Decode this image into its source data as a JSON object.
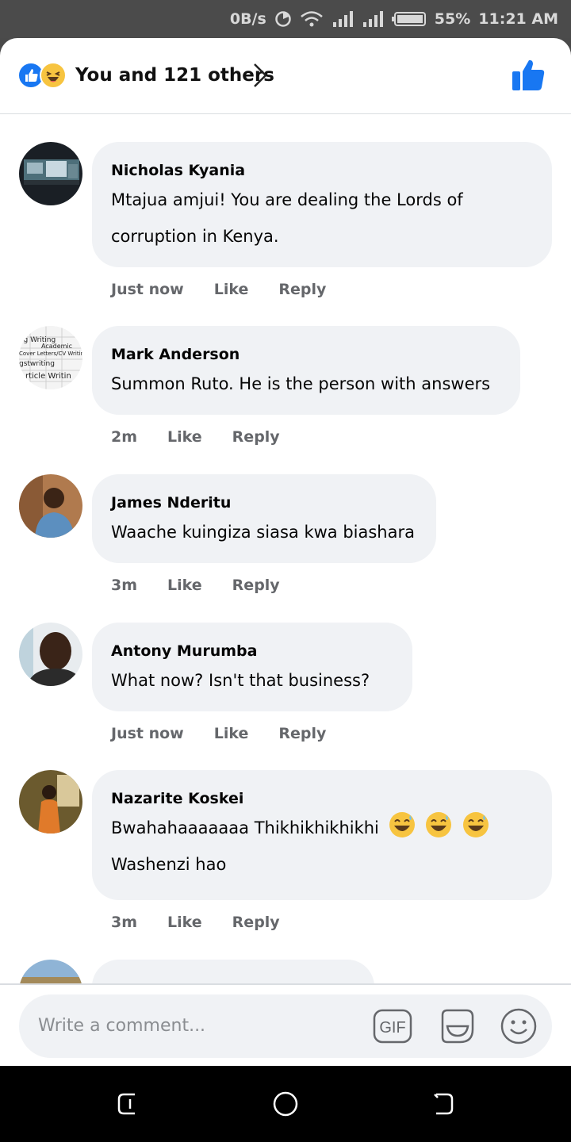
{
  "status": {
    "speed": "0B/s",
    "battery": "55%",
    "time": "11:21 AM"
  },
  "reactions": {
    "summary": "You and 121 others",
    "icons": [
      "like-icon",
      "haha-icon"
    ]
  },
  "comments": [
    {
      "author": "Nicholas Kyania",
      "lines": [
        "Mtajua amjui! You are dealing the Lords of",
        "corruption in Kenya."
      ],
      "time": "Just now",
      "like": "Like",
      "reply": "Reply"
    },
    {
      "author": "Mark Anderson",
      "lines": [
        "Summon Ruto. He is the person with answers"
      ],
      "time": "2m",
      "like": "Like",
      "reply": "Reply"
    },
    {
      "author": "James Nderitu",
      "lines": [
        "Waache kuingiza siasa kwa biashara"
      ],
      "time": "3m",
      "like": "Like",
      "reply": "Reply"
    },
    {
      "author": "Antony Murumba",
      "lines": [
        "What now? Isn't that business?"
      ],
      "time": "Just now",
      "like": "Like",
      "reply": "Reply"
    },
    {
      "author": "Nazarite Koskei",
      "lines": [
        "Bwahahaaaaaaa Thikhikhikhikhi",
        "Washenzi hao"
      ],
      "time": "3m",
      "like": "Like",
      "reply": "Reply"
    }
  ],
  "avatar_text": {
    "blog": "og Writing",
    "academic": "Academic",
    "cover": "Cover Letters/CV Writin",
    "ghost": "gstwriting",
    "article": "rticle Writin"
  },
  "composer": {
    "placeholder": "Write a comment...",
    "gif_label": "GIF"
  },
  "colors": {
    "accent": "#1877f2",
    "bubble": "#f0f2f5",
    "secondary_text": "#65676b"
  }
}
